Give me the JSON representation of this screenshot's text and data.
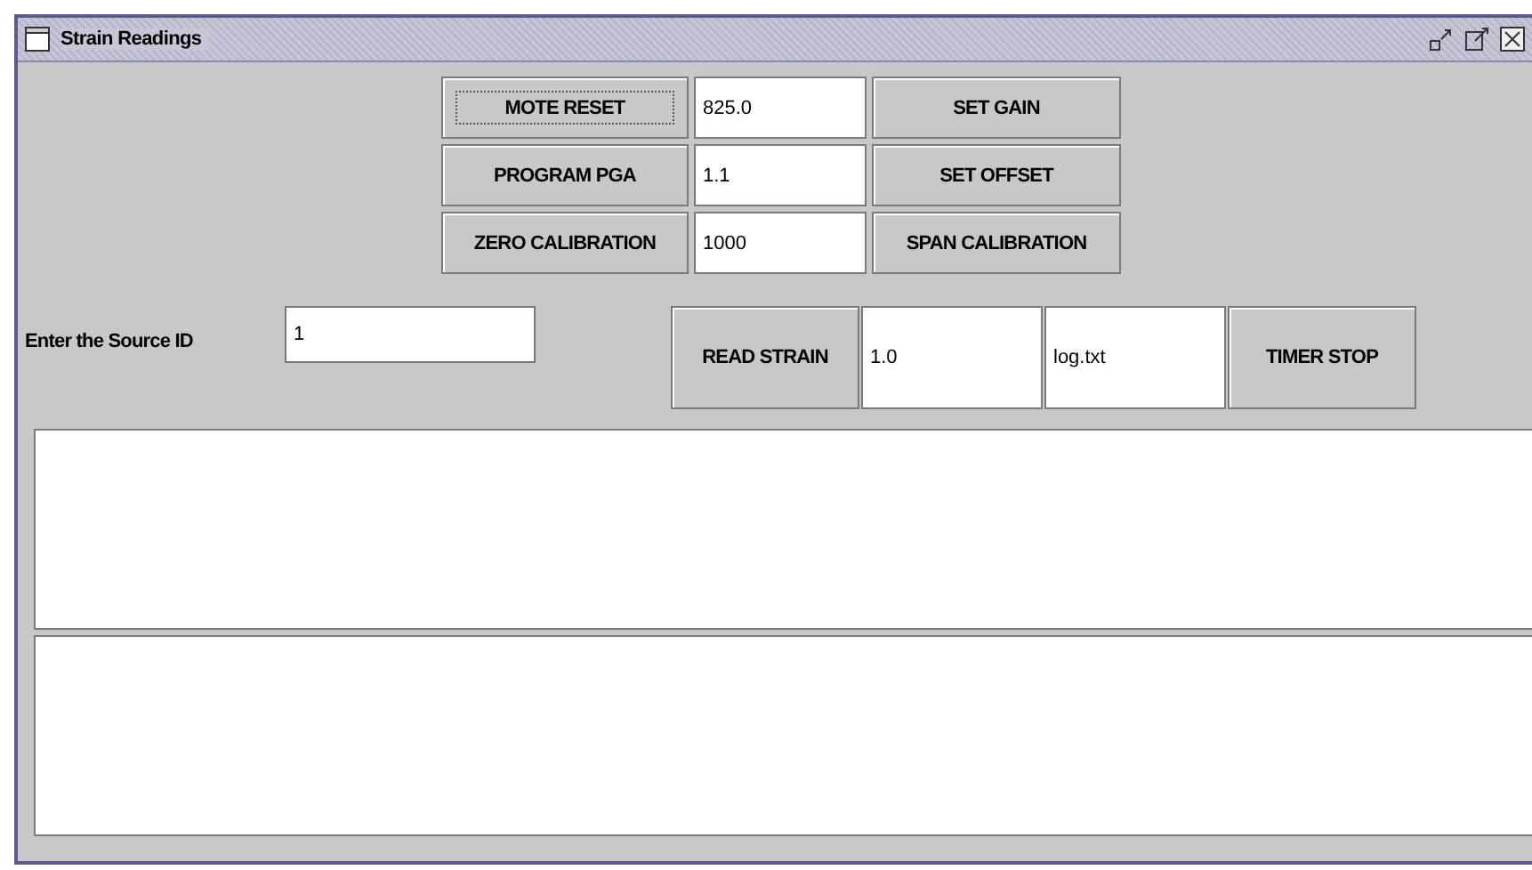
{
  "window": {
    "title": "Strain Readings"
  },
  "grid": [
    {
      "button": "MOTE RESET",
      "value": "825.0",
      "action": "SET GAIN",
      "focused": true
    },
    {
      "button": "PROGRAM PGA",
      "value": "1.1",
      "action": "SET OFFSET",
      "focused": false
    },
    {
      "button": "ZERO CALIBRATION",
      "value": "1000",
      "action": "SPAN CALIBRATION",
      "focused": false
    }
  ],
  "source": {
    "label": "Enter the Source ID",
    "value": "1"
  },
  "read": {
    "button": "READ STRAIN",
    "value": "1.0",
    "file": "log.txt",
    "timer": "TIMER STOP"
  }
}
